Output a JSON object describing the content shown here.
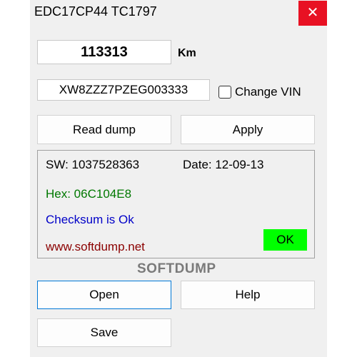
{
  "window": {
    "title": "EDC17CP44 TC1797",
    "close_glyph": "✕"
  },
  "mileage": {
    "value": "113313",
    "unit": "Km"
  },
  "vin": {
    "value": "XW8ZZZ7PZEG003333",
    "change_label": "Change VIN",
    "checked": false
  },
  "buttons": {
    "read_dump": "Read dump",
    "apply": "Apply",
    "open": "Open",
    "help": "Help",
    "save": "Save"
  },
  "info": {
    "sw": "SW: 1037528363",
    "date": "Date: 12-09-13",
    "hex": "Hex: 06C104E8",
    "checksum": "Checksum is Ok",
    "website": "www.softdump.net",
    "status": "OK"
  },
  "brand": "SOFTDUMP",
  "colors": {
    "close_bg": "#e81123",
    "hex_text": "#007800",
    "checksum_text": "#0000c8",
    "website_text": "#8b0000",
    "ok_bg": "#00ff00",
    "brand_text": "#7a7a7a",
    "focus_border": "#0078d7"
  }
}
